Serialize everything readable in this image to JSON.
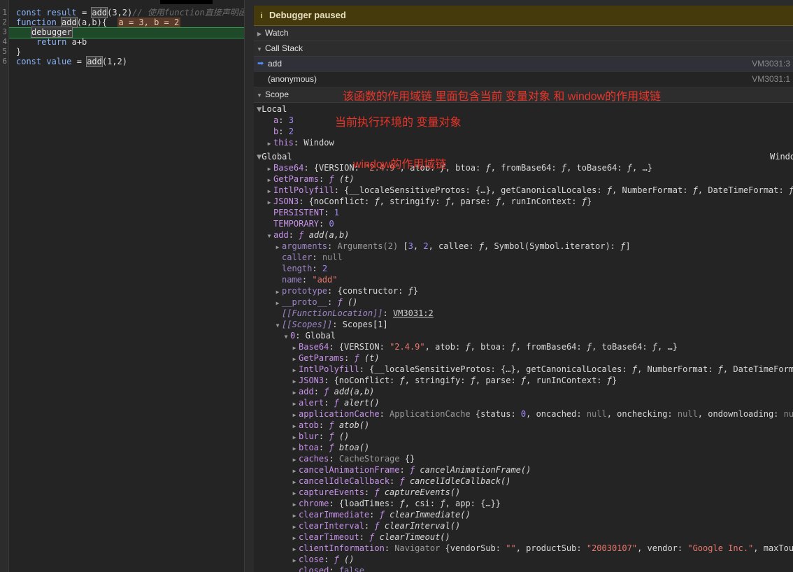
{
  "editor": {
    "line_numbers": [
      "1",
      "2",
      "3",
      "4",
      "5",
      "6"
    ],
    "line1": {
      "kw": "const",
      "var": "result",
      "eq": "=",
      "fn": "add",
      "args": "(3,2)",
      "comment": "// 使用function直接声明函"
    },
    "line2": {
      "kw": "function",
      "fn": "add",
      "params": "(a,b){",
      "inline": "a = 3, b = 2"
    },
    "line3": {
      "text": "debugger"
    },
    "line4": {
      "kw": "return",
      "expr": "a+b"
    },
    "line5": {
      "text": "}"
    },
    "line6": {
      "kw": "const",
      "var": "value",
      "eq": "=",
      "fn": "add",
      "args": "(1,2)"
    }
  },
  "debugger": {
    "paused_label": "Debugger paused",
    "info_icon": "i",
    "watch_label": "Watch",
    "callstack_label": "Call Stack",
    "frames": [
      {
        "name": "add",
        "location": "VM3031:3"
      },
      {
        "name": "(anonymous)",
        "location": "VM3031:1"
      }
    ],
    "scope_label": "Scope",
    "local_label": "Local",
    "global_label": "Global",
    "global_value": "Window"
  },
  "annotations": {
    "scope_chain": "该函数的作用域链 里面包含当前 变量对象 和 window的作用域链",
    "variable_object": "当前执行环境的 变量对象",
    "window_chain": "window的作用域链"
  },
  "colors": {
    "annotation": "#e8352a",
    "paused_bg": "#443a0c",
    "highlight_line": "#1f4a2a"
  }
}
